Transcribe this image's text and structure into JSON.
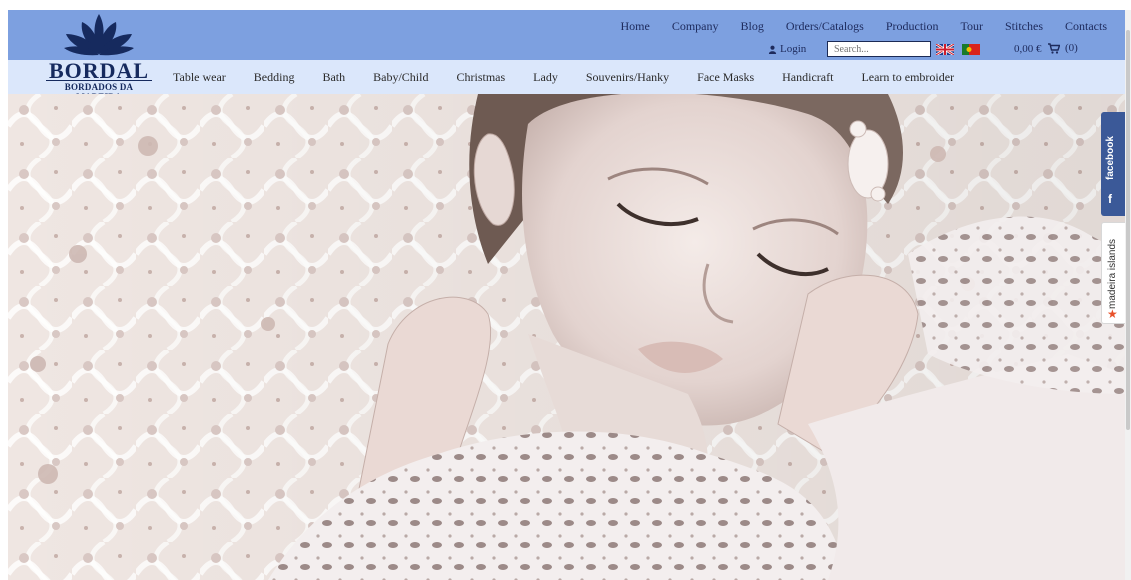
{
  "brand": {
    "name": "BORDAL",
    "tagline": "BORDADOS DA MADEIRA",
    "color": "#162a5e"
  },
  "top_nav": [
    {
      "label": "Home"
    },
    {
      "label": "Company"
    },
    {
      "label": "Blog"
    },
    {
      "label": "Orders/Catalogs"
    },
    {
      "label": "Production"
    },
    {
      "label": "Tour"
    },
    {
      "label": "Stitches"
    },
    {
      "label": "Contacts"
    }
  ],
  "utility": {
    "login_label": "Login",
    "search_placeholder": "Search...",
    "cart_total": "0,00 €",
    "cart_count": "(0)"
  },
  "main_menu": [
    {
      "label": "Table wear"
    },
    {
      "label": "Bedding"
    },
    {
      "label": "Bath"
    },
    {
      "label": "Baby/Child"
    },
    {
      "label": "Christmas"
    },
    {
      "label": "Lady"
    },
    {
      "label": "Souvenirs/Hanky"
    },
    {
      "label": "Face Masks"
    },
    {
      "label": "Handicraft"
    },
    {
      "label": "Learn to embroider"
    }
  ],
  "side_tabs": {
    "facebook_label": "facebook",
    "madeira_label": "madeira islands"
  },
  "colors": {
    "topbar": "#7da0e0",
    "menubar": "#dbe7fb",
    "facebook": "#3b5998"
  }
}
